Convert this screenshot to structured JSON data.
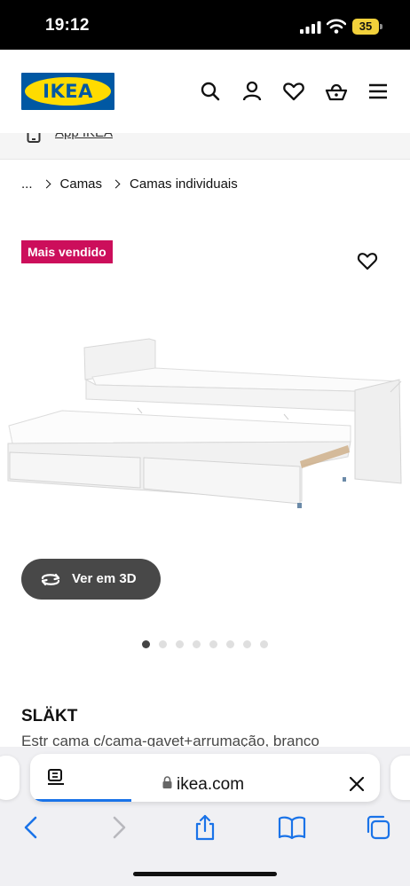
{
  "status_bar": {
    "time": "19:12",
    "battery_level": "35"
  },
  "header": {
    "logo_text": "IKEA",
    "icons": [
      "search-icon",
      "account-icon",
      "heart-icon",
      "basket-icon",
      "menu-icon"
    ]
  },
  "app_strip": {
    "label": "App IKEA"
  },
  "breadcrumb": {
    "items": [
      "...",
      "Camas",
      "Camas individuais"
    ]
  },
  "product": {
    "badge": "Mais vendido",
    "view_3d_label": "Ver em 3D",
    "image_count": 8,
    "active_image": 1,
    "name": "SLÄKT",
    "description": "Estr cama c/cama-gavet+arrumação, branco"
  },
  "safari": {
    "url": "ikea.com",
    "load_progress": 0.29
  },
  "colors": {
    "ikea_blue": "#0058a3",
    "ikea_yellow": "#ffdb00",
    "badge": "#cc0e5b",
    "safari_accent": "#1a73e8"
  }
}
